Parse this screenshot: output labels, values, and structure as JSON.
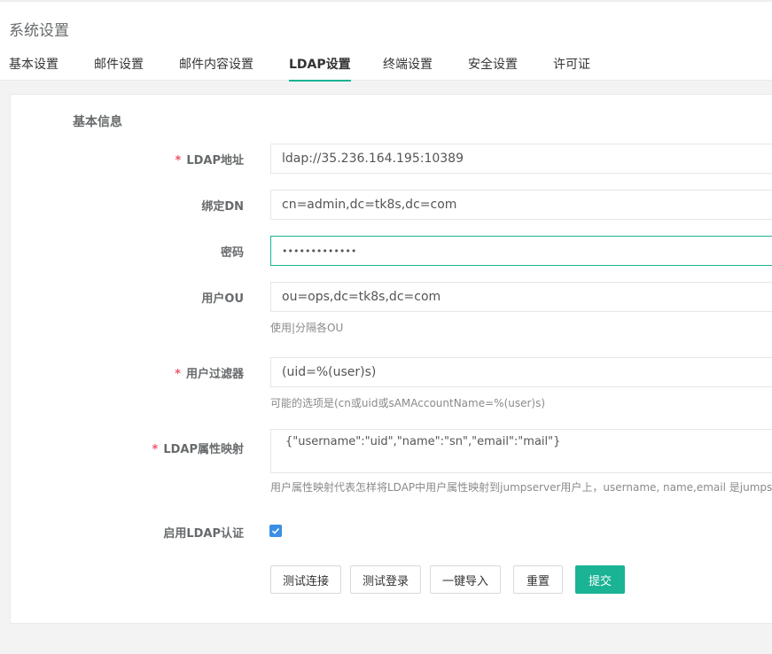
{
  "page": {
    "title": "系统设置"
  },
  "tabs": [
    {
      "label": "基本设置",
      "active": false
    },
    {
      "label": "邮件设置",
      "active": false
    },
    {
      "label": "邮件内容设置",
      "active": false
    },
    {
      "label": "LDAP设置",
      "active": true
    },
    {
      "label": "终端设置",
      "active": false
    },
    {
      "label": "安全设置",
      "active": false
    },
    {
      "label": "许可证",
      "active": false
    }
  ],
  "form": {
    "section_title": "基本信息",
    "required_mark": "*",
    "ldap_address": {
      "label": "LDAP地址",
      "value": "ldap://35.236.164.195:10389"
    },
    "bind_dn": {
      "label": "绑定DN",
      "value": "cn=admin,dc=tk8s,dc=com"
    },
    "password": {
      "label": "密码",
      "value": "•••••••••••••"
    },
    "user_ou": {
      "label": "用户OU",
      "value": "ou=ops,dc=tk8s,dc=com",
      "help": "使用|分隔各OU"
    },
    "user_filter": {
      "label": "用户过滤器",
      "value": "(uid=%(user)s)",
      "help": "可能的选项是(cn或uid或sAMAccountName=%(user)s)"
    },
    "attr_map": {
      "label": "LDAP属性映射",
      "value": "{\"username\":\"uid\",\"name\":\"sn\",\"email\":\"mail\"}",
      "help": "用户属性映射代表怎样将LDAP中用户属性映射到jumpserver用户上，username, name,email 是jumpserver的"
    },
    "enable_ldap": {
      "label": "启用LDAP认证",
      "checked": true
    }
  },
  "buttons": {
    "test_connection": "测试连接",
    "test_login": "测试登录",
    "import": "一键导入",
    "reset": "重置",
    "submit": "提交"
  },
  "colors": {
    "accent": "#1ab394",
    "required": "#ed5565",
    "checkbox": "#3b8fe5"
  }
}
